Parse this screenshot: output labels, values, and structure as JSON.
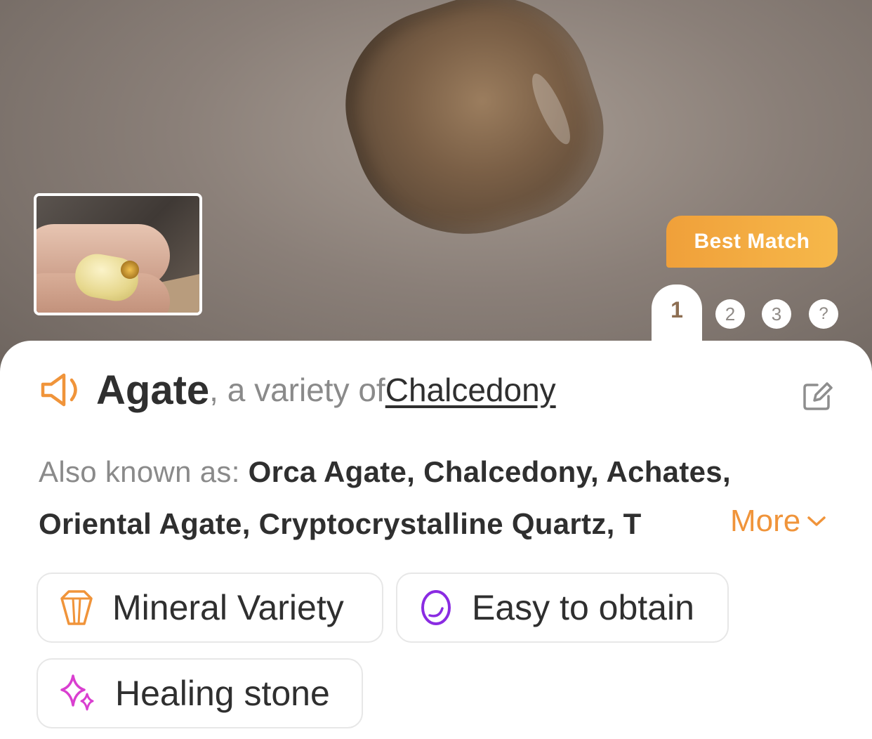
{
  "hero": {
    "badge": "Best Match",
    "pager": [
      "1",
      "2",
      "3",
      "?"
    ],
    "selected_index": 0
  },
  "title": {
    "name": "Agate",
    "sub": ", a variety of ",
    "link": "Chalcedony"
  },
  "aka": {
    "label": "Also known as: ",
    "line1": "Orca Agate, Chalcedony, Achates,",
    "line2": "Oriental Agate, Cryptocrystalline Quartz, T",
    "more": "More"
  },
  "chips": [
    {
      "label": "Mineral Variety",
      "icon": "crystal-icon",
      "color": "#f0943a"
    },
    {
      "label": "Easy to obtain",
      "icon": "oval-stone-icon",
      "color": "#8a2be2"
    },
    {
      "label": "Healing stone",
      "icon": "sparkle-icon",
      "color": "#d93fd0"
    }
  ],
  "colors": {
    "accent": "#f0943a",
    "text": "#2f2f2f",
    "muted": "#8a8a8a"
  }
}
